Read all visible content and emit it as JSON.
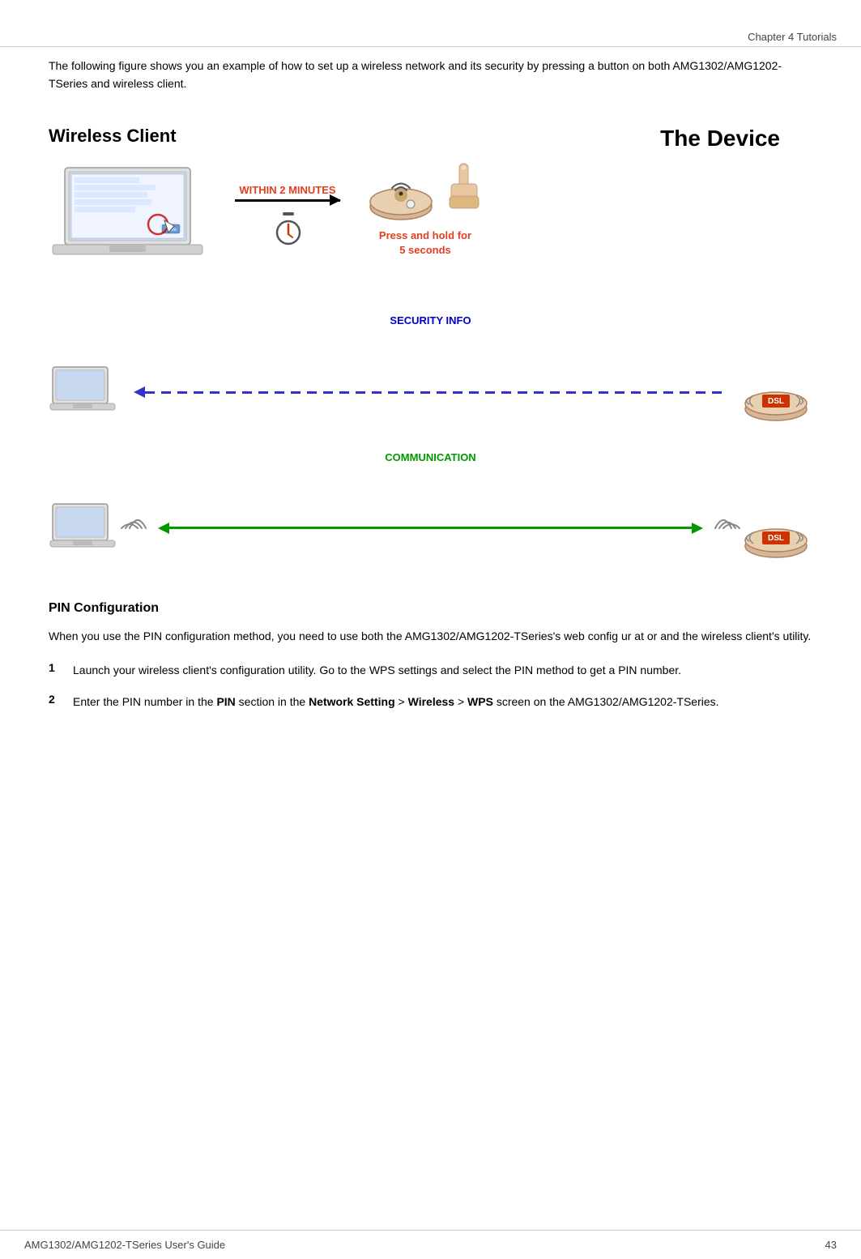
{
  "header": {
    "chapter": "Chapter 4 Tutorials"
  },
  "footer": {
    "guide_name": "AMG1302/AMG1202-TSeries User's Guide",
    "page_number": "43"
  },
  "intro_text": "The following figure shows you an example of how to set up a wireless network and its security by pressing a button on both AMG1302/AMG1202-TSeries and wireless client.",
  "diagram": {
    "label_wireless": "Wireless Client",
    "label_device": "The Device",
    "step1": {
      "within_label": "WITHIN 2 MINUTES",
      "press_hold_label": "Press and hold for\n5 seconds"
    },
    "step2": {
      "security_label": "SECURITY INFO"
    },
    "step3": {
      "comm_label": "COMMUNICATION"
    }
  },
  "pin_section": {
    "title": "PIN Configuration",
    "intro": "When you use the PIN configuration method, you need to use both the AMG1302/AMG1202-TSeries's web config ur at or and the wireless client's utility.",
    "steps": [
      {
        "num": "1",
        "text": "Launch your wireless client's configuration utility. Go to the WPS settings and select the PIN method to get a PIN number."
      },
      {
        "num": "2",
        "text_parts": [
          {
            "type": "normal",
            "text": "Enter the PIN number in the "
          },
          {
            "type": "bold",
            "text": "PIN"
          },
          {
            "type": "normal",
            "text": " section in the "
          },
          {
            "type": "bold",
            "text": "Network Setting"
          },
          {
            "type": "normal",
            "text": " > "
          },
          {
            "type": "bold",
            "text": "Wireless"
          },
          {
            "type": "normal",
            "text": " > "
          },
          {
            "type": "bold",
            "text": "WPS"
          },
          {
            "type": "normal",
            "text": " screen on the AMG1302/AMG1202-TSeries."
          }
        ]
      }
    ]
  }
}
